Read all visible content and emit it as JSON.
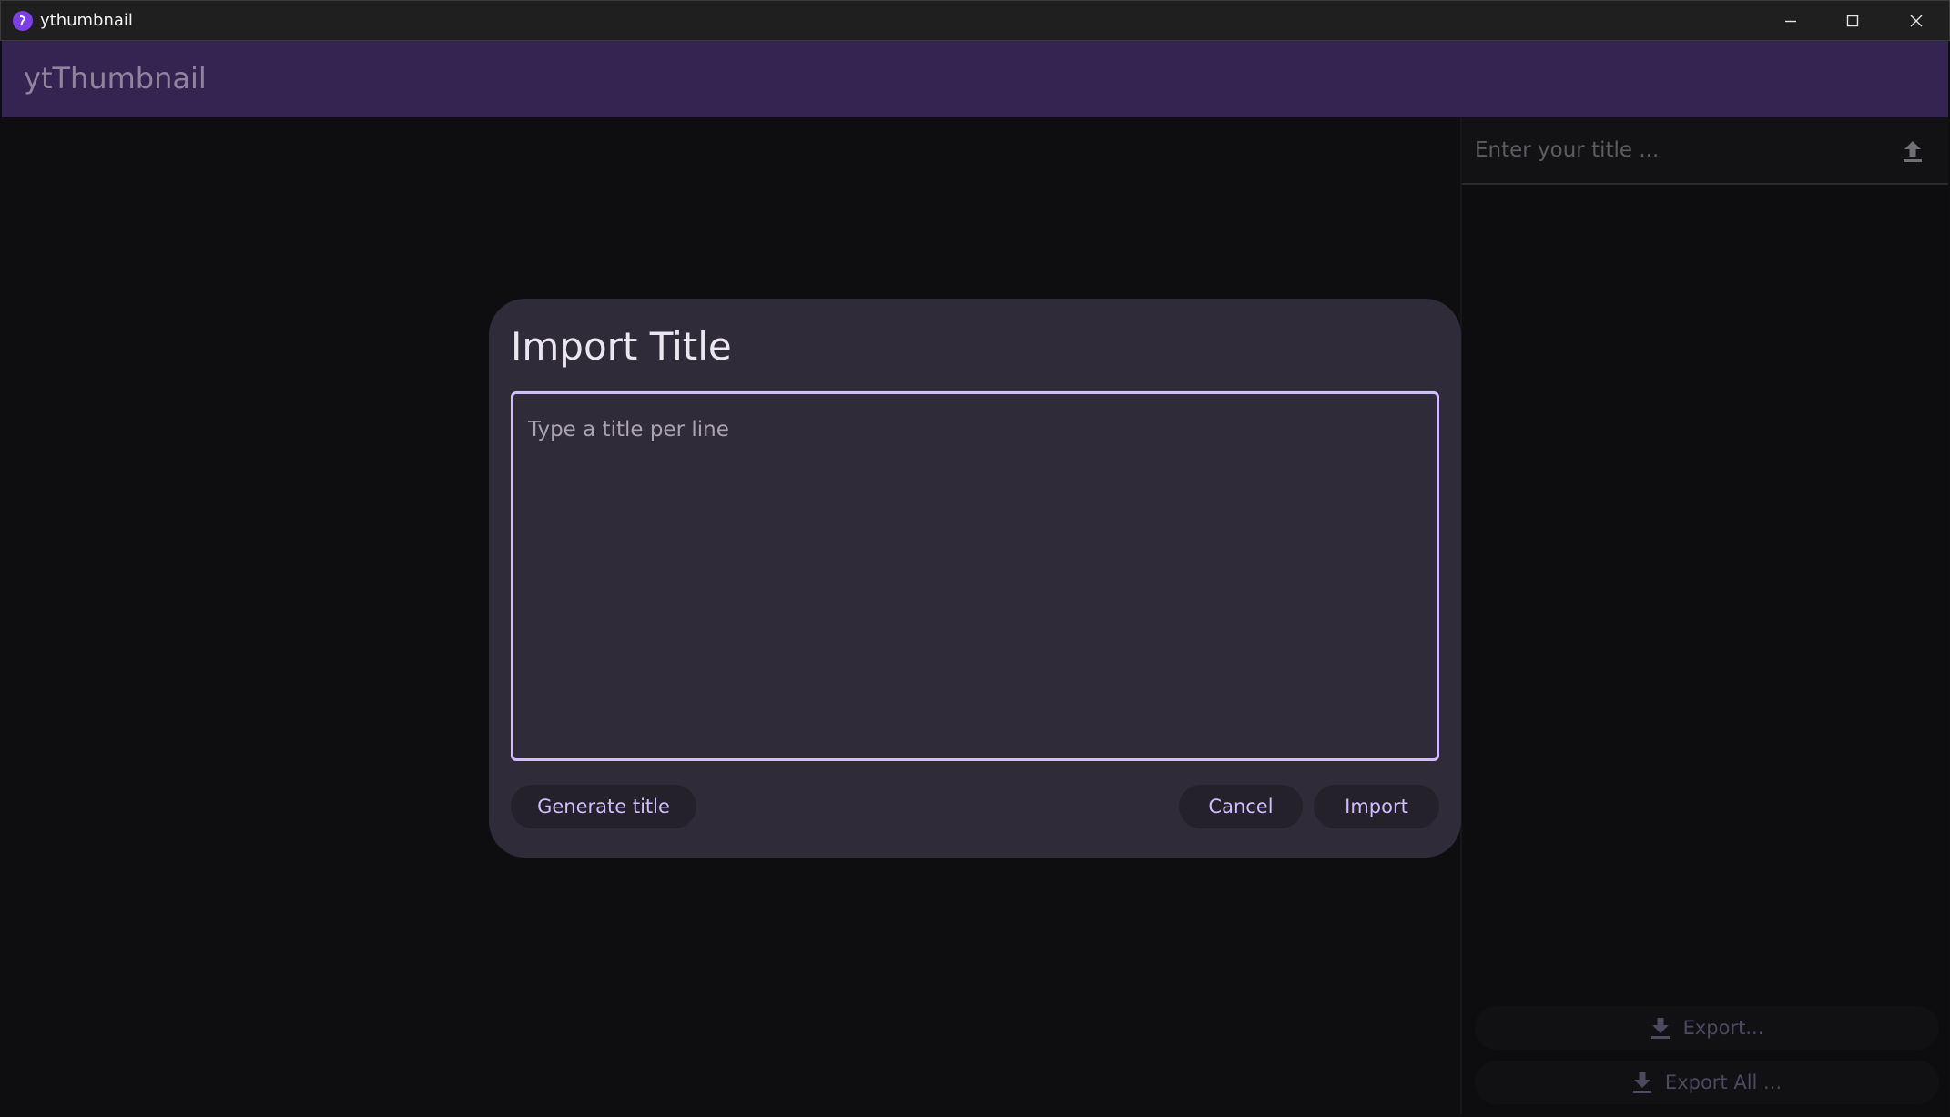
{
  "window": {
    "title": "ythumbnail",
    "icon": "app-logo-icon",
    "controls": [
      "minimize-icon",
      "maximize-icon",
      "close-icon"
    ]
  },
  "appbar": {
    "title": "ytThumbnail"
  },
  "sidebar": {
    "title_input": {
      "placeholder": "Enter your title ...",
      "value": ""
    },
    "upload_icon": "upload-icon",
    "export_label": "Export...",
    "export_all_label": "Export All ..."
  },
  "dialog": {
    "title": "Import Title",
    "textarea_placeholder": "Type a title per line",
    "textarea_value": "",
    "generate_label": "Generate title",
    "cancel_label": "Cancel",
    "import_label": "Import"
  },
  "colors": {
    "appbar_bg": "#332451",
    "dialog_bg": "#2f2b38",
    "accent": "#d0bcff",
    "background": "#0e0e11"
  }
}
